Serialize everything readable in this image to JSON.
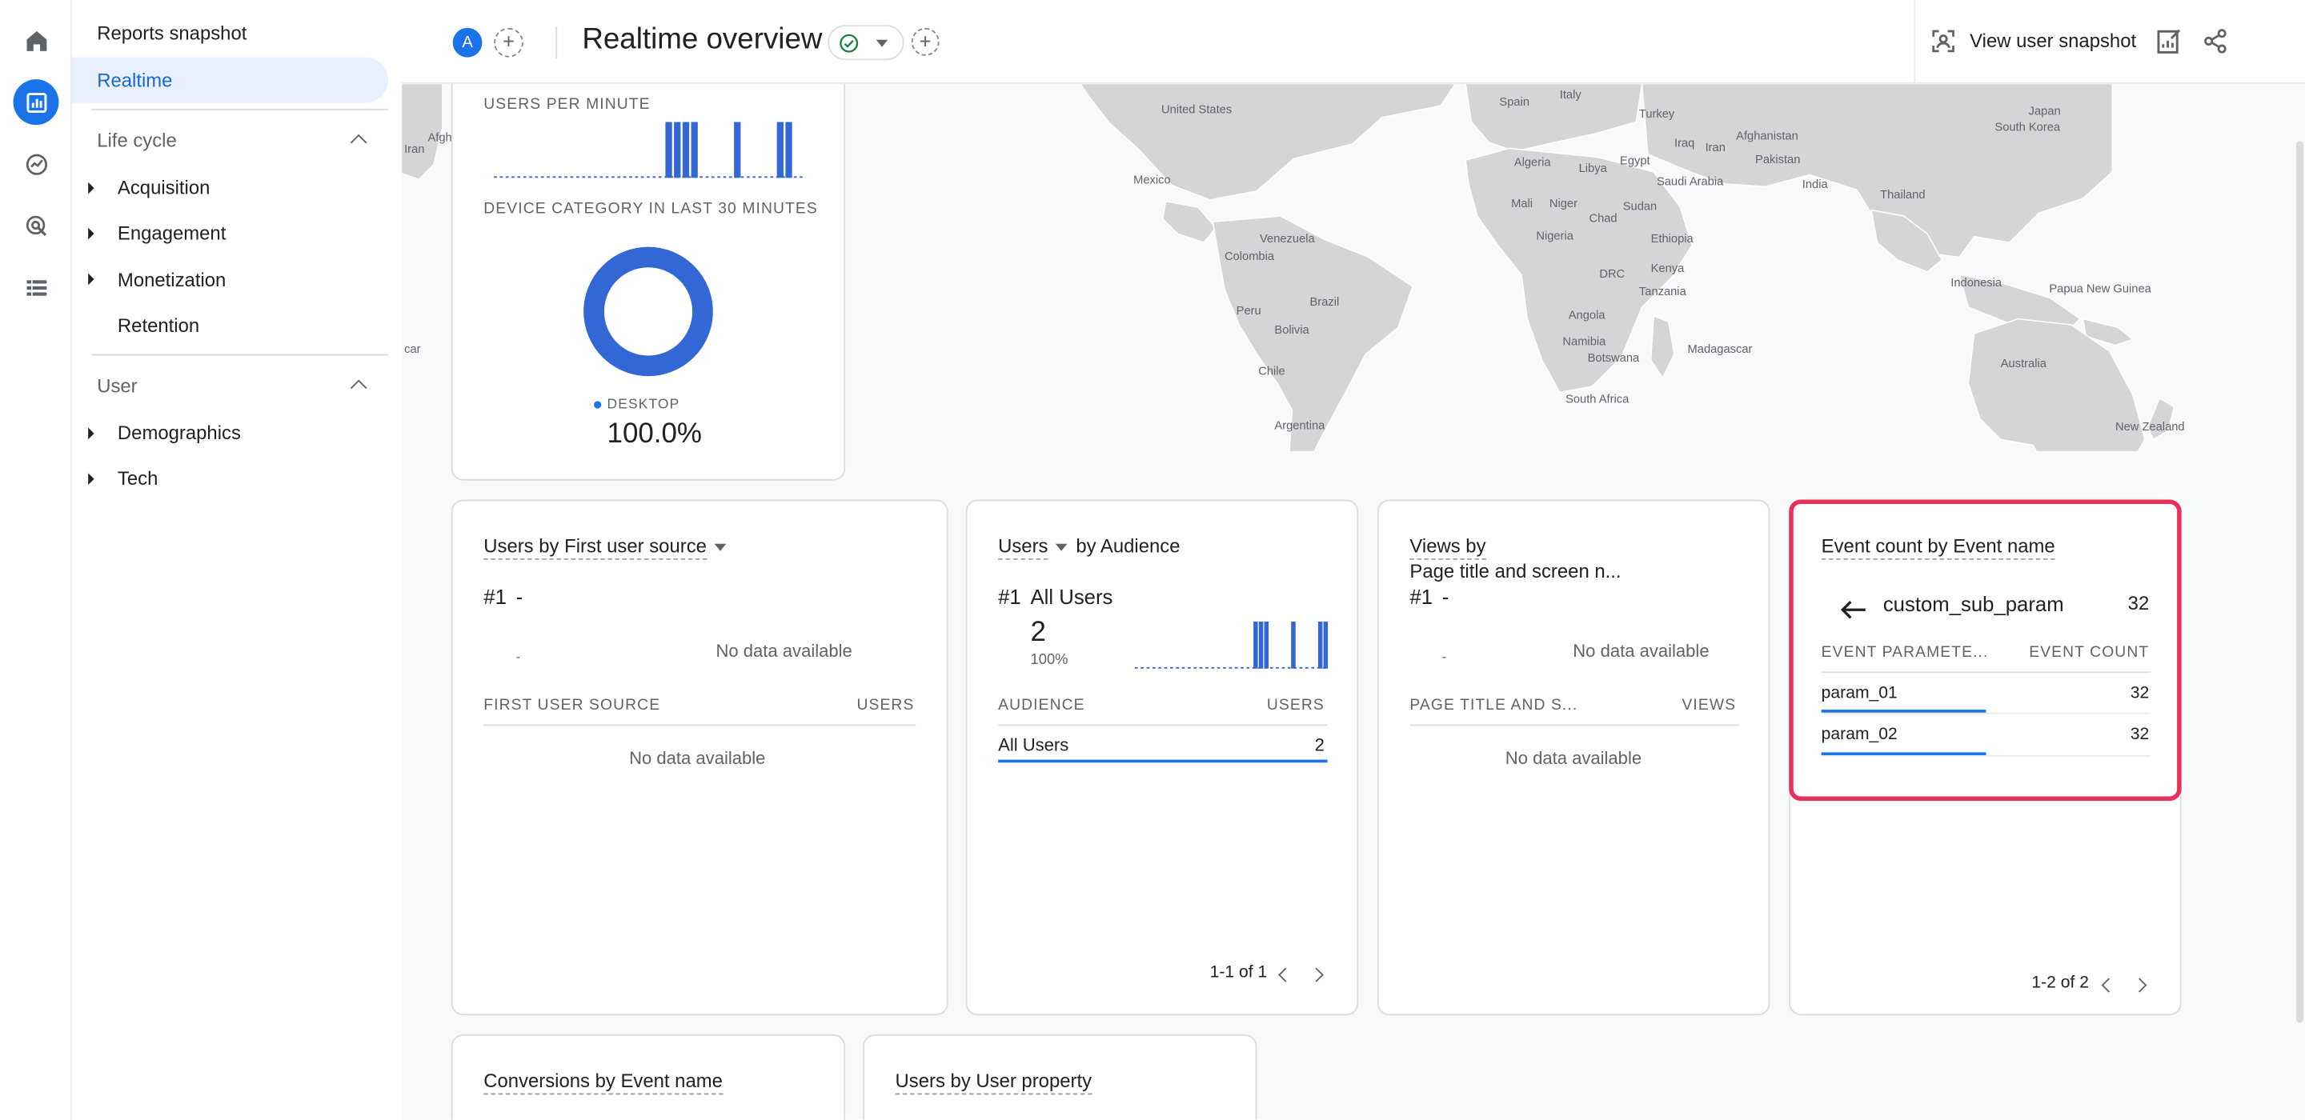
{
  "sidebar": {
    "title": "Reports snapshot",
    "realtime": "Realtime",
    "section_lifecycle": "Life cycle",
    "lifecycle_items": [
      "Acquisition",
      "Engagement",
      "Monetization",
      "Retention"
    ],
    "section_user": "User",
    "user_items": [
      "Demographics",
      "Tech"
    ]
  },
  "header": {
    "avatar_letter": "A",
    "title": "Realtime overview",
    "view_snapshot": "View user snapshot"
  },
  "map": {
    "labels": [
      "United States",
      "Mexico",
      "Venezuela",
      "Colombia",
      "Peru",
      "Brazil",
      "Bolivia",
      "Chile",
      "Argentina",
      "Spain",
      "Italy",
      "Algeria",
      "Libya",
      "Egypt",
      "Mali",
      "Niger",
      "Chad",
      "Sudan",
      "Nigeria",
      "Ethiopia",
      "DRC",
      "Kenya",
      "Tanzania",
      "Angola",
      "Namibia",
      "Botswana",
      "South Africa",
      "Madagascar",
      "Turkey",
      "Iraq",
      "Iran",
      "Saudi Arabia",
      "Afghanistan",
      "Pakistan",
      "India",
      "Thailand",
      "Indonesia",
      "Papua New Guinea",
      "Australia",
      "New Zealand",
      "Japan",
      "South Korea",
      "Afgh",
      "Iran",
      "car"
    ]
  },
  "users_card": {
    "per_minute_label": "USERS PER MINUTE",
    "device_label": "DEVICE CATEGORY IN LAST 30 MINUTES",
    "legend": "DESKTOP",
    "percent": "100.0%",
    "desktop_share": 1.0,
    "bars": [
      0,
      0,
      0,
      0,
      0,
      0,
      0,
      0,
      0,
      0,
      0,
      0,
      0,
      0,
      0,
      0,
      0,
      0,
      0,
      0,
      1,
      1,
      1,
      1,
      0,
      0,
      0,
      0,
      1,
      0,
      0,
      0,
      0,
      1,
      1,
      0
    ]
  },
  "card_source": {
    "title": "Users by First user source",
    "rank": "#1",
    "rank_value": "-",
    "dash": "-",
    "no_data_top": "No data available",
    "col1": "FIRST USER SOURCE",
    "col2": "USERS",
    "no_data": "No data available"
  },
  "card_audience": {
    "title_metric": "Users",
    "title_rest": "by Audience",
    "rank": "#1",
    "rank_value": "All Users",
    "big": "2",
    "pct": "100%",
    "col1": "AUDIENCE",
    "col2": "USERS",
    "row_name": "All Users",
    "row_value": "2",
    "pager": "1-1 of 1",
    "bars": [
      0,
      0,
      0,
      0,
      0,
      0,
      0,
      0,
      0,
      0,
      0,
      0,
      0,
      0,
      0,
      0,
      0,
      0,
      0,
      0,
      0,
      0,
      1,
      1,
      1,
      0,
      0,
      0,
      0,
      1,
      0,
      0,
      0,
      0,
      1,
      1
    ]
  },
  "card_views": {
    "title_line1": "Views by",
    "title_line2": "Page title and screen n...",
    "rank": "#1",
    "rank_value": "-",
    "dash": "-",
    "no_data_top": "No data available",
    "col1": "PAGE TITLE AND S...",
    "col2": "VIEWS",
    "no_data": "No data available"
  },
  "card_events": {
    "title": "Event count by Event name",
    "sub_name": "custom_sub_param",
    "sub_value": "32",
    "col1": "EVENT PARAMETE...",
    "col2": "EVENT COUNT",
    "rows": [
      {
        "name": "param_01",
        "value": "32"
      },
      {
        "name": "param_02",
        "value": "32"
      }
    ],
    "pager": "1-2 of 2"
  },
  "card_conversions": {
    "title": "Conversions by Event name"
  },
  "card_user_property": {
    "title": "Users by User property"
  },
  "colors": {
    "accent": "#1a73e8",
    "highlight": "#e8305b",
    "donut": "#3367d6"
  }
}
